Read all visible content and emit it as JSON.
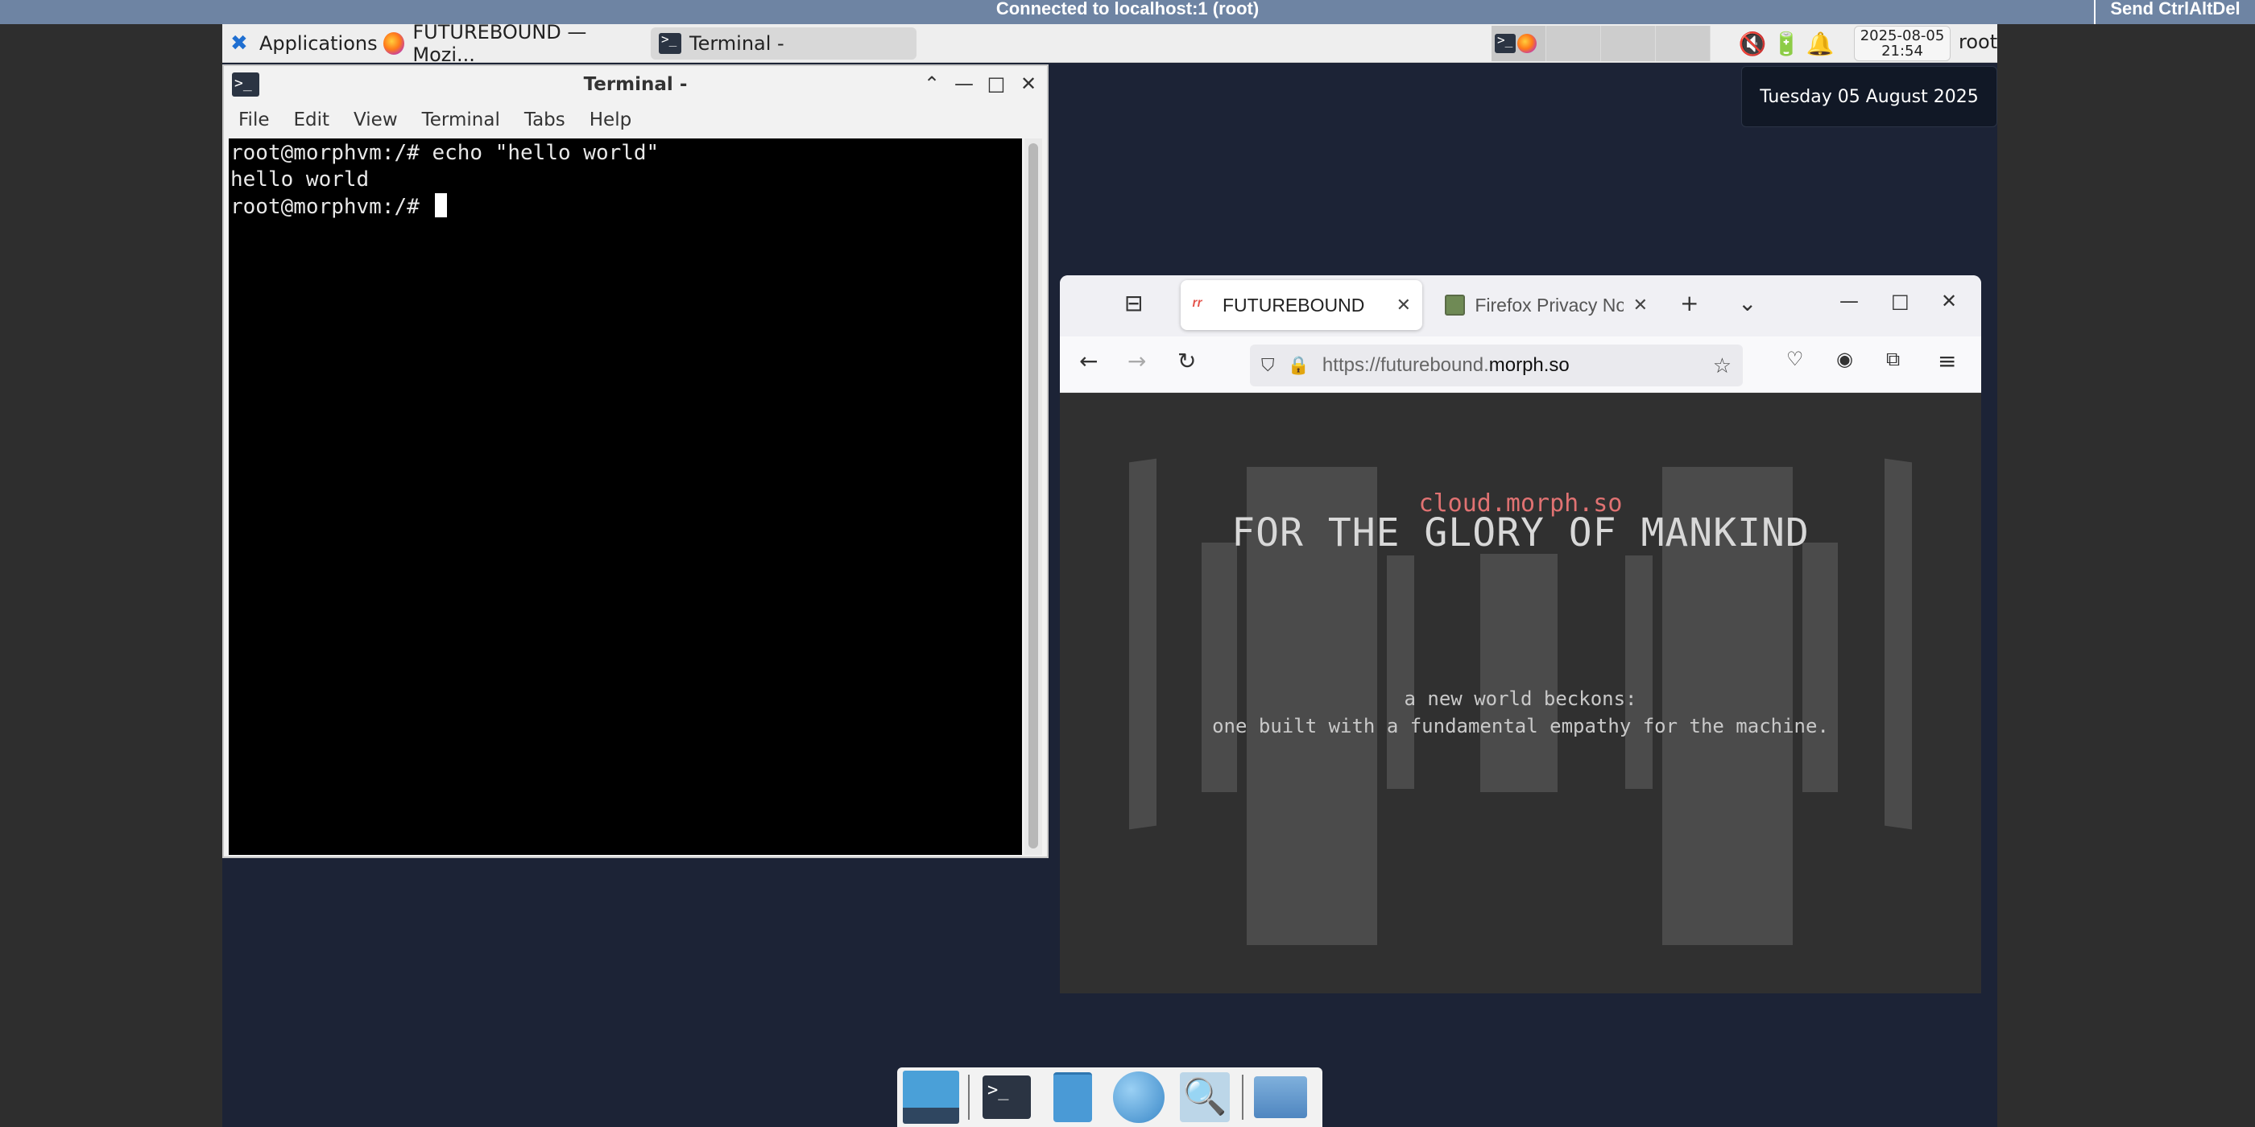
{
  "vnc": {
    "title": "Connected to localhost:1 (root)",
    "send_label": "Send CtrlAltDel"
  },
  "panel": {
    "apps_label": "Applications",
    "tasks": [
      {
        "label": "FUTUREBOUND — Mozi...",
        "icon": "firefox-icon"
      },
      {
        "label": "Terminal -",
        "icon": "terminal-icon"
      }
    ],
    "clock_date": "2025-08-05",
    "clock_time": "21:54",
    "user": "root"
  },
  "date_popup": "Tuesday 05 August 2025",
  "terminal": {
    "title": "Terminal -",
    "menu": [
      "File",
      "Edit",
      "View",
      "Terminal",
      "Tabs",
      "Help"
    ],
    "lines": [
      "root@morphvm:/# echo \"hello world\"",
      "hello world",
      "root@morphvm:/# "
    ]
  },
  "firefox": {
    "tabs": [
      {
        "label": "FUTUREBOUND",
        "active": true
      },
      {
        "label": "Firefox Privacy No",
        "active": false
      }
    ],
    "url_host": "https://futurebound.",
    "url_domain": "morph.so",
    "page": {
      "subtitle": "cloud.morph.so",
      "title": "FOR THE GLORY OF MANKIND",
      "line1": "a new world beckons:",
      "line2": "one built with a fundamental empathy for the machine."
    }
  },
  "dock": {
    "items": [
      "show-desktop",
      "terminal",
      "file-manager",
      "web-browser",
      "app-finder",
      "folder"
    ]
  },
  "colors": {
    "vnc_bar": "#6e84a3",
    "desktop_bg": "#1c2336",
    "site_accent": "#e07272",
    "site_bg": "#303030"
  }
}
